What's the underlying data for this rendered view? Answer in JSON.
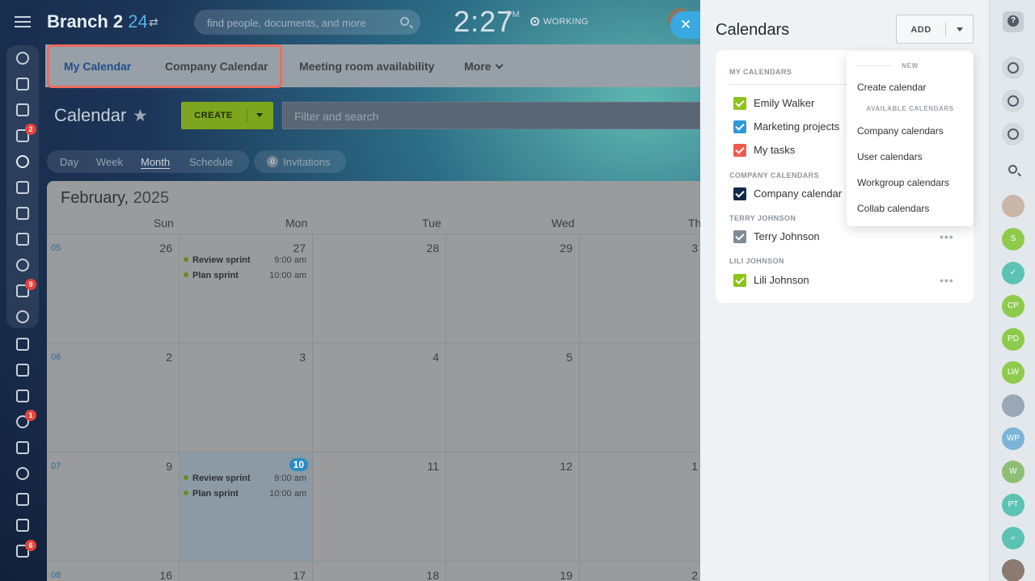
{
  "header": {
    "brand": "Branch 2",
    "brand_num": "24",
    "search_placeholder": "find people, documents, and more",
    "time": "2:27",
    "ampm": "PM",
    "status": "WORKING"
  },
  "leftbar": {
    "badges": [
      "2",
      "9",
      "1",
      "6"
    ]
  },
  "topnav": {
    "tabs": [
      "My Calendar",
      "Company Calendar",
      "Meeting room availability",
      "More"
    ]
  },
  "toolbar": {
    "title": "Calendar",
    "create_label": "CREATE",
    "filter_placeholder": "Filter and search"
  },
  "views": {
    "items": [
      "Day",
      "Week",
      "Month",
      "Schedule"
    ],
    "active": "Month",
    "invitations_count": "0",
    "invitations_label": "Invitations"
  },
  "calendar": {
    "month": "February,",
    "year": "2025",
    "weekdays": [
      "Sun",
      "Mon",
      "Tue",
      "Wed",
      "Th"
    ],
    "weeks": [
      {
        "num": "05",
        "days": [
          "26",
          "27",
          "28",
          "29",
          "3"
        ]
      },
      {
        "num": "06",
        "days": [
          "2",
          "3",
          "4",
          "5",
          ""
        ]
      },
      {
        "num": "07",
        "days": [
          "9",
          "10",
          "11",
          "12",
          "1"
        ]
      },
      {
        "num": "08",
        "days": [
          "16",
          "17",
          "18",
          "19",
          "2"
        ]
      }
    ],
    "events": [
      {
        "title": "Review sprint",
        "time": "9:00 am"
      },
      {
        "title": "Plan sprint",
        "time": "10:00 am"
      }
    ]
  },
  "panel": {
    "title": "Calendars",
    "add_label": "ADD",
    "sections": {
      "my": "MY CALENDARS",
      "company": "COMPANY CALENDARS",
      "terry": "TERRY JOHNSON",
      "lili": "LILI JOHNSON"
    },
    "calendars": [
      {
        "name": "Emily Walker",
        "color": "#8ec31b"
      },
      {
        "name": "Marketing projects",
        "color": "#2f9ad8"
      },
      {
        "name": "My tasks",
        "color": "#ef5a50"
      },
      {
        "name": "Company calendar",
        "color": "#14294a"
      },
      {
        "name": "Terry Johnson",
        "color": "#7f8a95"
      },
      {
        "name": "Lili Johnson",
        "color": "#8ec31b"
      }
    ],
    "more_dots": "•••"
  },
  "dropdown": {
    "new_header": "NEW",
    "create": "Create calendar",
    "available_header": "AVAILABLE CALENDARS",
    "items": [
      "Company calendars",
      "User calendars",
      "Workgroup calendars",
      "Collab calendars"
    ]
  },
  "rail": {
    "avatars": [
      {
        "initials": "S",
        "color": "#8ecb4c"
      },
      {
        "initials": "CP",
        "color": "#8ecb4c"
      },
      {
        "initials": "PD",
        "color": "#8ecb4c"
      },
      {
        "initials": "LW",
        "color": "#8ecb4c"
      },
      {
        "initials": "WP",
        "color": "#7cb4d8"
      },
      {
        "initials": "W",
        "color": "#8cbf73"
      },
      {
        "initials": "PT",
        "color": "#5cc3b3"
      }
    ]
  }
}
